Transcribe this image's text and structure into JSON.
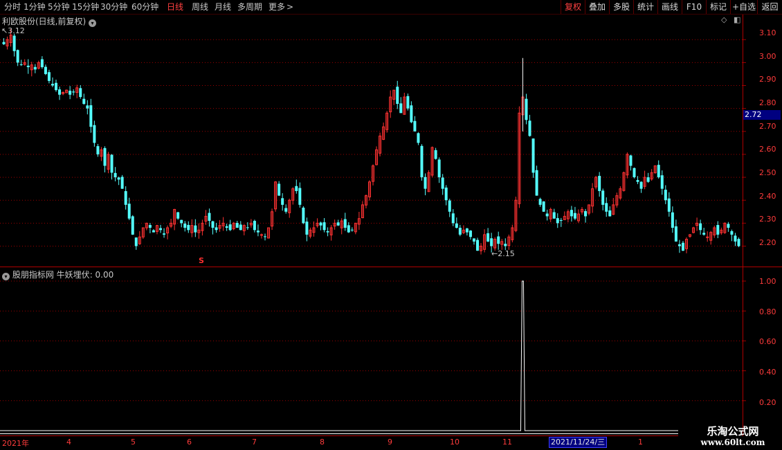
{
  "toolbar": {
    "timeframes": [
      {
        "label": "分时",
        "active": false
      },
      {
        "label": "1分钟",
        "active": false
      },
      {
        "label": "5分钟",
        "active": false
      },
      {
        "label": "15分钟",
        "active": false
      },
      {
        "label": "30分钟",
        "active": false
      },
      {
        "label": "60分钟",
        "active": false
      },
      {
        "label": "日线",
        "active": true
      },
      {
        "label": "周线",
        "active": false
      },
      {
        "label": "月线",
        "active": false
      },
      {
        "label": "多周期",
        "active": false
      },
      {
        "label": "更多",
        "active": false
      }
    ],
    "more_arrow": ">",
    "right_buttons": [
      "复权",
      "叠加",
      "多股",
      "统计",
      "画线",
      "F10",
      "标记",
      "+自选",
      "返回"
    ]
  },
  "main_panel": {
    "title": "利欧股份(日线,前复权)",
    "current_price": "2.72",
    "high_label": "3.12",
    "low_label": "2.15",
    "marker": "S",
    "y_ticks": [
      "3.10",
      "3.00",
      "2.90",
      "2.80",
      "2.70",
      "2.60",
      "2.50",
      "2.40",
      "2.30",
      "2.20"
    ]
  },
  "indicator_panel": {
    "title": "股朋指标网",
    "indicator_name": "牛妖埋伏",
    "indicator_value": "0.00",
    "y_ticks": [
      "1.00",
      "0.80",
      "0.60",
      "0.40",
      "0.20"
    ]
  },
  "x_axis": {
    "labels": [
      "2021年",
      "4",
      "5",
      "6",
      "7",
      "8",
      "9",
      "10",
      "11",
      "1"
    ],
    "cursor_date": "2021/11/24/三"
  },
  "watermark": {
    "name": "乐淘公式网",
    "url": "www.60lt.com"
  },
  "colors": {
    "up": "#ff3232",
    "down": "#54ffff",
    "grid": "#a00000",
    "axis_label": "#ff3b3b",
    "active": "#ff4040"
  },
  "chart_data": {
    "type": "candlestick",
    "main": {
      "y_range": [
        2.12,
        3.14
      ],
      "close_path": [
        3.08,
        3.1,
        3.12,
        3.05,
        3.0,
        2.99,
        3.0,
        2.98,
        2.99,
        2.97,
        3.0,
        2.98,
        2.95,
        2.92,
        2.9,
        2.88,
        2.86,
        2.87,
        2.88,
        2.86,
        2.87,
        2.89,
        2.85,
        2.82,
        2.8,
        2.72,
        2.65,
        2.6,
        2.62,
        2.55,
        2.6,
        2.52,
        2.5,
        2.49,
        2.45,
        2.38,
        2.32,
        2.25,
        2.2,
        2.24,
        2.28,
        2.3,
        2.28,
        2.26,
        2.29,
        2.27,
        2.25,
        2.28,
        2.3,
        2.36,
        2.32,
        2.3,
        2.28,
        2.27,
        2.29,
        2.26,
        2.27,
        2.3,
        2.33,
        2.31,
        2.28,
        2.27,
        2.29,
        2.3,
        2.28,
        2.27,
        2.3,
        2.28,
        2.27,
        2.29,
        2.28,
        2.3,
        2.27,
        2.26,
        2.25,
        2.24,
        2.28,
        2.35,
        2.48,
        2.42,
        2.38,
        2.35,
        2.4,
        2.45,
        2.44,
        2.38,
        2.3,
        2.25,
        2.27,
        2.28,
        2.3,
        2.29,
        2.27,
        2.26,
        2.28,
        2.3,
        2.29,
        2.31,
        2.28,
        2.26,
        2.27,
        2.3,
        2.32,
        2.38,
        2.42,
        2.48,
        2.55,
        2.62,
        2.68,
        2.72,
        2.78,
        2.85,
        2.88,
        2.82,
        2.78,
        2.85,
        2.8,
        2.74,
        2.7,
        2.65,
        2.5,
        2.45,
        2.52,
        2.63,
        2.58,
        2.5,
        2.45,
        2.4,
        2.35,
        2.3,
        2.28,
        2.25,
        2.27,
        2.26,
        2.24,
        2.22,
        2.18,
        2.2,
        2.25,
        2.22,
        2.2,
        2.23,
        2.21,
        2.22,
        2.2,
        2.24,
        2.28,
        2.4,
        2.78,
        2.85,
        2.75,
        2.68,
        2.52,
        2.42,
        2.38,
        2.35,
        2.33,
        2.36,
        2.32,
        2.3,
        2.31,
        2.33,
        2.35,
        2.33,
        2.32,
        2.34,
        2.36,
        2.33,
        2.38,
        2.45,
        2.5,
        2.44,
        2.38,
        2.35,
        2.33,
        2.38,
        2.42,
        2.45,
        2.52,
        2.6,
        2.55,
        2.5,
        2.48,
        2.45,
        2.5,
        2.48,
        2.52,
        2.55,
        2.5,
        2.45,
        2.4,
        2.35,
        2.28,
        2.22,
        2.2,
        2.18,
        2.23,
        2.25,
        2.28,
        2.3,
        2.27,
        2.25,
        2.24,
        2.26,
        2.28,
        2.25,
        2.27,
        2.3,
        2.28,
        2.25,
        2.22,
        2.2
      ]
    },
    "indicator": {
      "y_range": [
        0.0,
        1.0
      ],
      "spike_index": 149,
      "spike_value": 1.0
    }
  }
}
